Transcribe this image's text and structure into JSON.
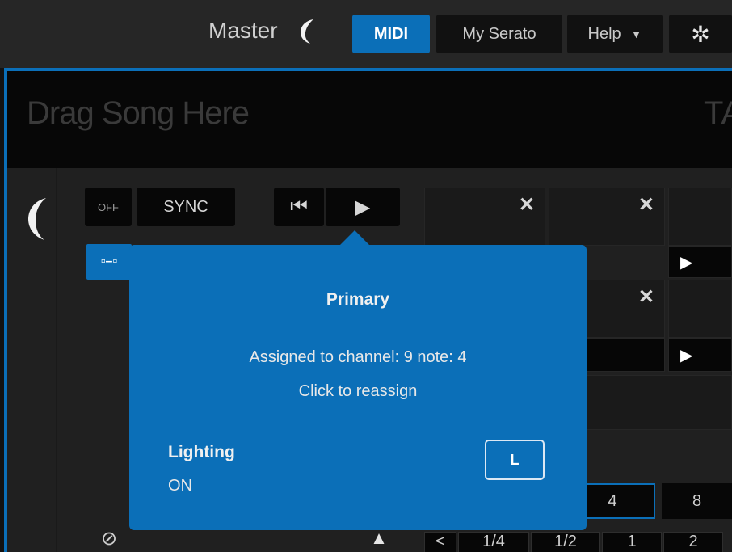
{
  "topbar": {
    "master_label": "Master",
    "midi_label": "MIDI",
    "my_serato_label": "My Serato",
    "help_label": "Help",
    "help_caret": "▼",
    "gear_icon": "✲",
    "accent": "#0b6fb8"
  },
  "deck": {
    "drag_song_text": "Drag Song Here",
    "partial_text": "TA",
    "off_label": "OFF",
    "sync_label": "SYNC",
    "prev_icon": "⏮",
    "play_icon": "▶",
    "link_icon": "▫–▫",
    "tempo_icon": "⊘",
    "up_icon": "▲"
  },
  "pads": {
    "clear_icon": "✕",
    "play_icon": "▶",
    "loop_values": [
      "4",
      "8"
    ],
    "beat_values": [
      "<",
      "1/4",
      "1/2",
      "1",
      "2"
    ]
  },
  "popup": {
    "title": "Primary",
    "assigned_text": "Assigned to channel: 9 note: 4",
    "reassign_text": "Click to reassign",
    "lighting_label": "Lighting",
    "lighting_value": "ON",
    "key_label": "L"
  }
}
